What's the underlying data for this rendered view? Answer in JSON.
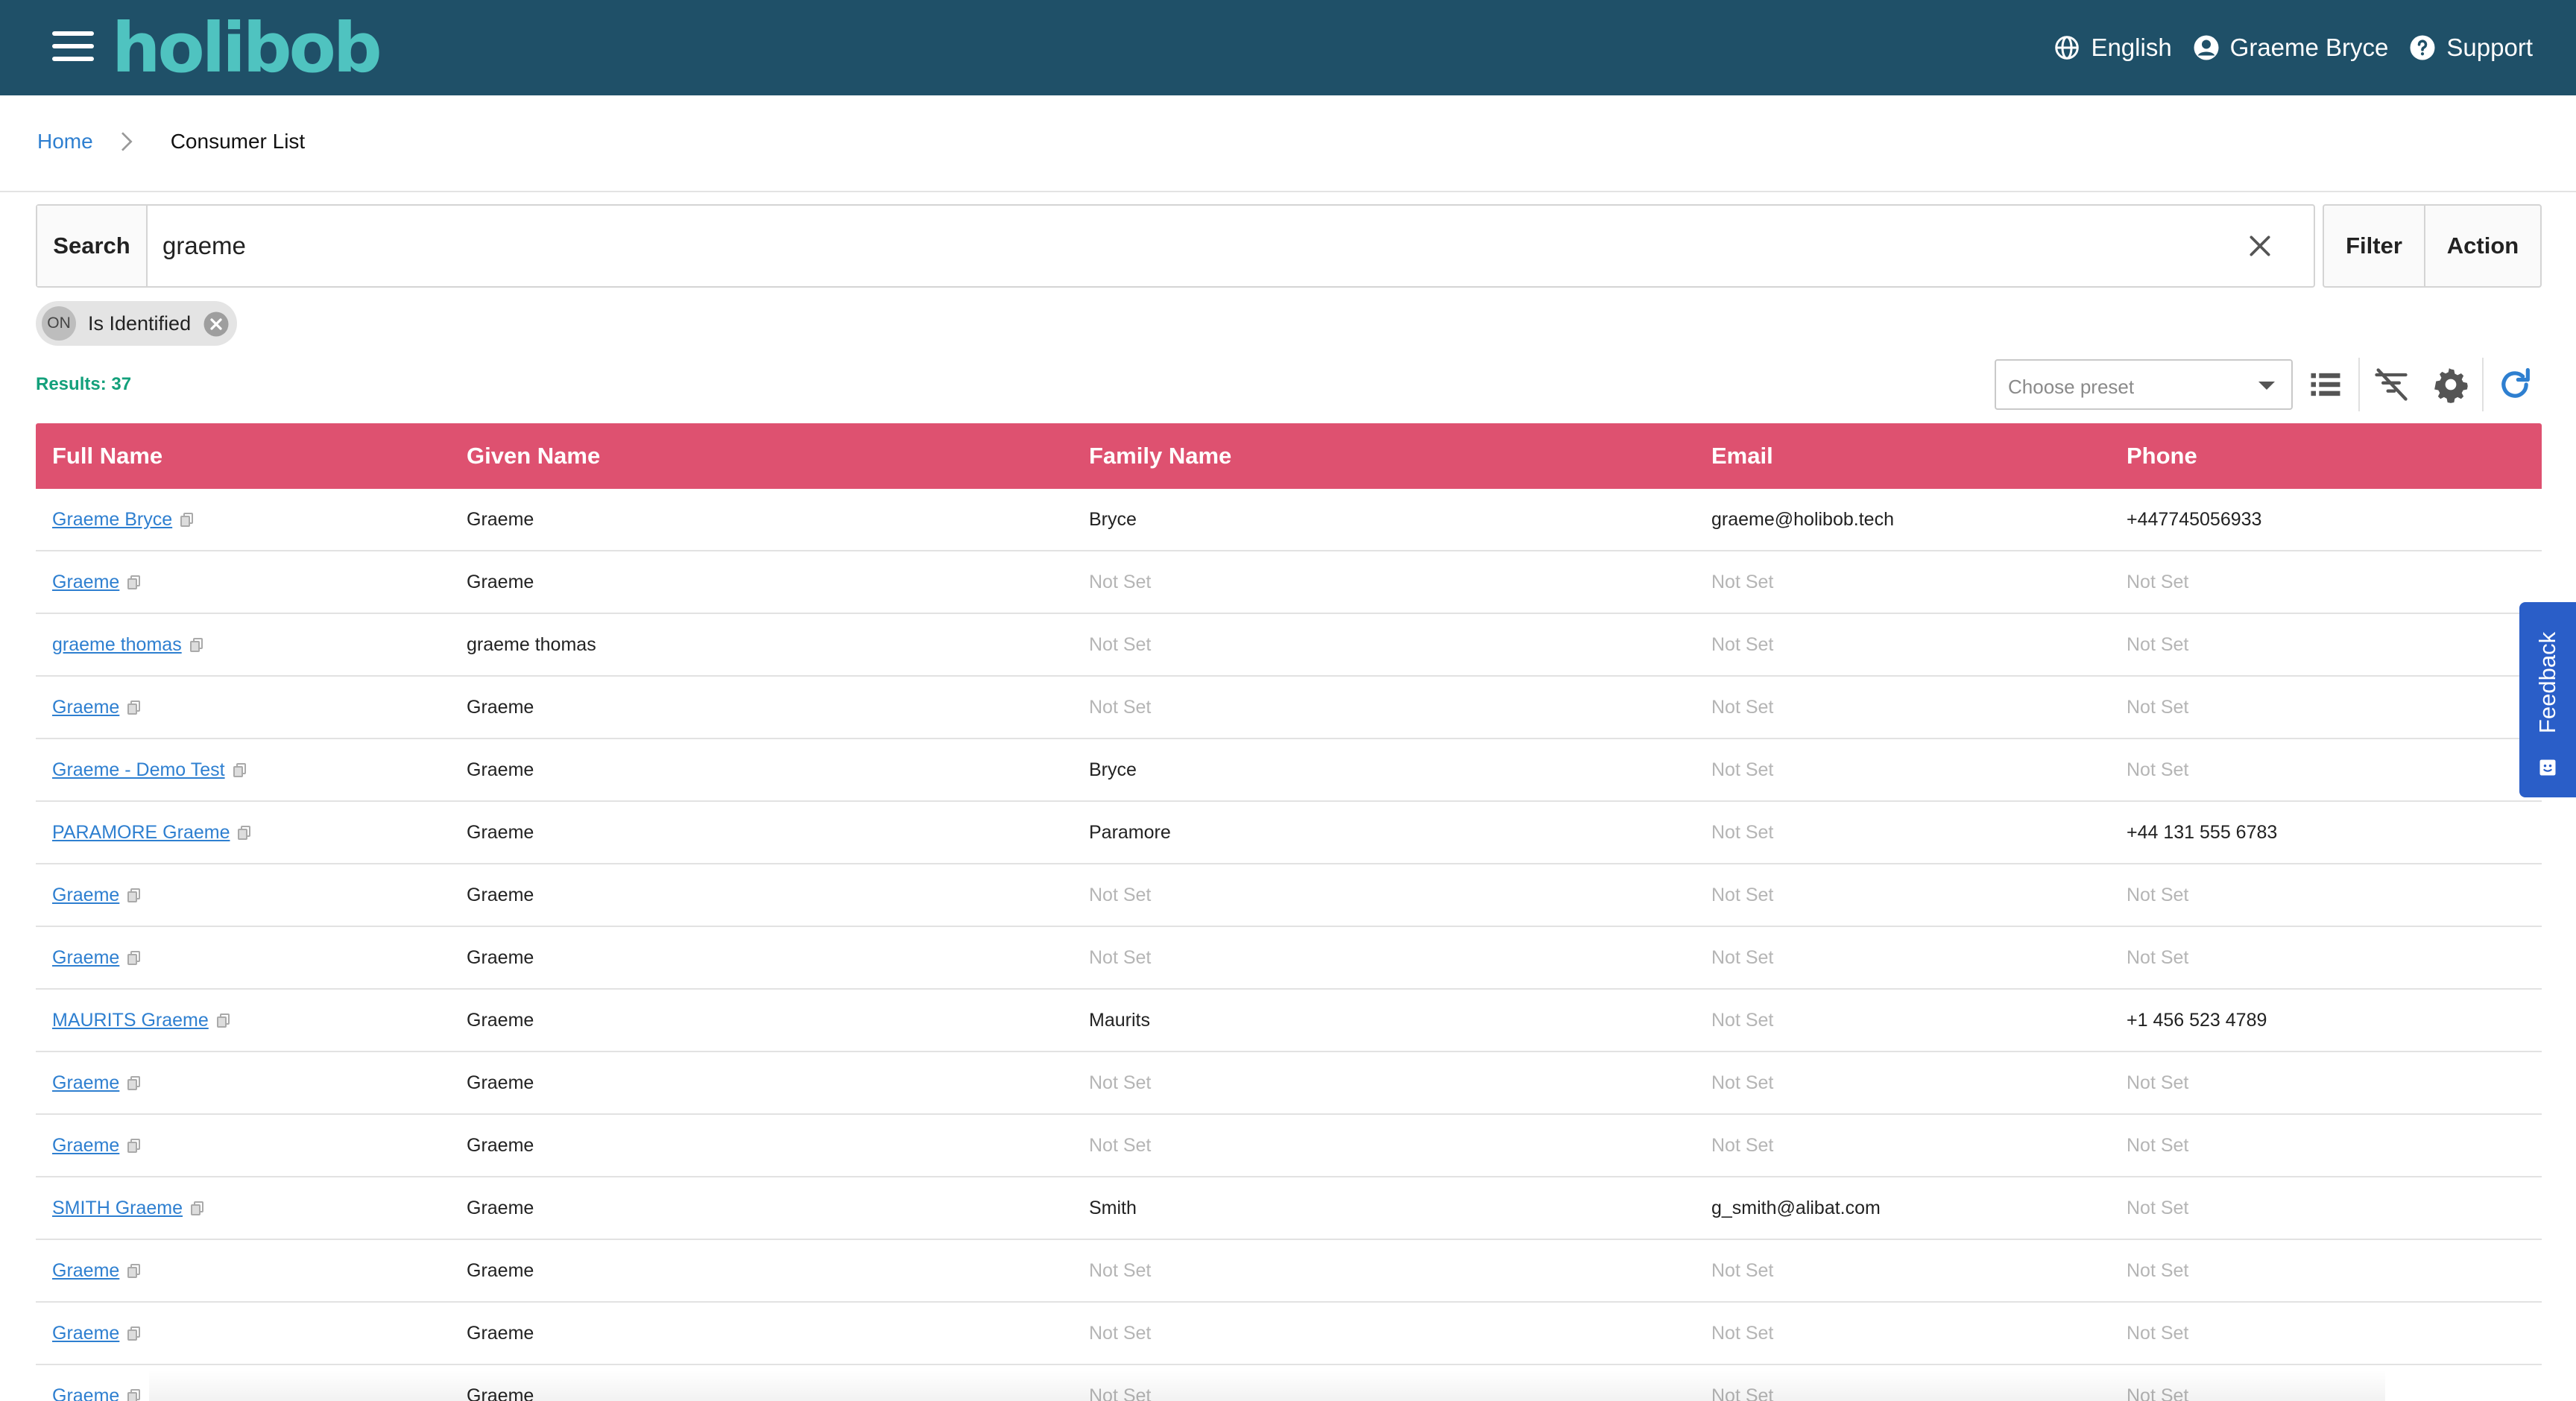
{
  "header": {
    "logo": "holibob",
    "language": "English",
    "user_name": "Graeme Bryce",
    "support": "Support"
  },
  "breadcrumb": {
    "home": "Home",
    "current": "Consumer List"
  },
  "search": {
    "label": "Search",
    "value": "graeme"
  },
  "buttons": {
    "filter": "Filter",
    "action": "Action"
  },
  "chip": {
    "badge": "ON",
    "label": "Is Identified"
  },
  "results": "Results: 37",
  "preset": {
    "placeholder": "Choose preset"
  },
  "table": {
    "columns": [
      "Full Name",
      "Given Name",
      "Family Name",
      "Email",
      "Phone"
    ],
    "rows": [
      [
        "Graeme Bryce",
        "Graeme",
        "Bryce",
        "graeme@holibob.tech",
        "+447745056933"
      ],
      [
        "Graeme",
        "Graeme",
        "Not Set",
        "Not Set",
        "Not Set"
      ],
      [
        "graeme thomas",
        "graeme thomas",
        "Not Set",
        "Not Set",
        "Not Set"
      ],
      [
        "Graeme",
        "Graeme",
        "Not Set",
        "Not Set",
        "Not Set"
      ],
      [
        "Graeme - Demo Test",
        "Graeme",
        "Bryce",
        "Not Set",
        "Not Set"
      ],
      [
        "PARAMORE Graeme",
        "Graeme",
        "Paramore",
        "Not Set",
        "+44 131 555 6783"
      ],
      [
        "Graeme",
        "Graeme",
        "Not Set",
        "Not Set",
        "Not Set"
      ],
      [
        "Graeme",
        "Graeme",
        "Not Set",
        "Not Set",
        "Not Set"
      ],
      [
        "MAURITS Graeme",
        "Graeme",
        "Maurits",
        "Not Set",
        "+1 456 523 4789"
      ],
      [
        "Graeme",
        "Graeme",
        "Not Set",
        "Not Set",
        "Not Set"
      ],
      [
        "Graeme",
        "Graeme",
        "Not Set",
        "Not Set",
        "Not Set"
      ],
      [
        "SMITH Graeme",
        "Graeme",
        "Smith",
        "g_smith@alibat.com",
        "Not Set"
      ],
      [
        "Graeme",
        "Graeme",
        "Not Set",
        "Not Set",
        "Not Set"
      ],
      [
        "Graeme",
        "Graeme",
        "Not Set",
        "Not Set",
        "Not Set"
      ],
      [
        "Graeme",
        "Graeme",
        "Not Set",
        "Not Set",
        "Not Set"
      ]
    ]
  },
  "feedback": "Feedback",
  "colors": {
    "header_bg": "#1f5068",
    "logo": "#4fc3c0",
    "table_header": "#de5170",
    "link": "#2e7fd0",
    "results": "#13a07b",
    "feedback": "#2a5ec8"
  },
  "icons": [
    "menu-icon",
    "globe-icon",
    "user-icon",
    "help-icon",
    "chevron-right-icon",
    "close-icon",
    "list-view-icon",
    "clear-filter-icon",
    "gear-icon",
    "refresh-icon",
    "copy-icon",
    "feedback-icon"
  ]
}
